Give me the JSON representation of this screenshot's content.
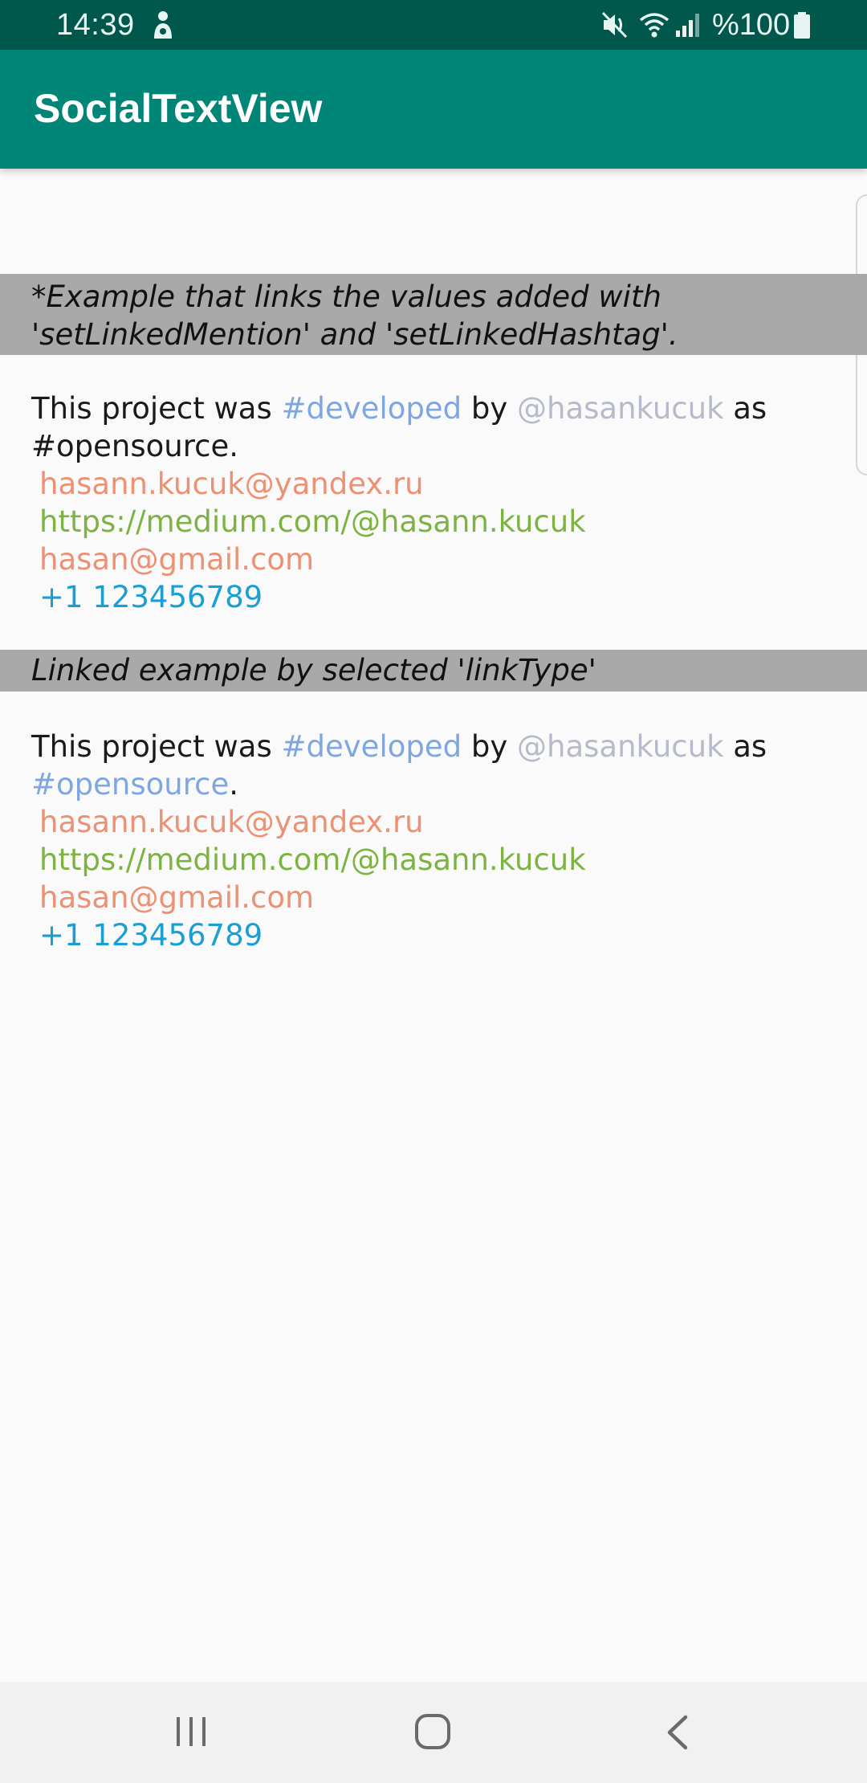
{
  "status_bar": {
    "time": "14:39",
    "battery_text": "%100",
    "icons": [
      "person-icon",
      "mute-icon",
      "wifi-icon",
      "signal-icon",
      "battery-icon"
    ]
  },
  "app_bar": {
    "title": "SocialTextView",
    "color": "#008577"
  },
  "section1": {
    "header_line1": "*Example that links the values added with",
    "header_line2": "'setLinkedMention' and 'setLinkedHashtag'.",
    "text": {
      "prefix": "This project was ",
      "hashtag1": "#developed",
      "by": " by ",
      "mention": "@hasankucuk",
      "as": " as",
      "hashtag2": "#opensource",
      "period": ".",
      "email1": "hasann.kucuk@yandex.ru",
      "url": "https://medium.com/@hasann.kucuk",
      "email2": "hasan@gmail.com",
      "phone": "+1 123456789"
    }
  },
  "section2": {
    "header": "Linked example by selected 'linkType'",
    "text": {
      "prefix": "This project was ",
      "hashtag1": "#developed",
      "by": " by ",
      "mention": "@hasankucuk",
      "as": " as",
      "hashtag2": "#opensource",
      "period": ".",
      "email1": "hasann.kucuk@yandex.ru",
      "url": "https://medium.com/@hasann.kucuk",
      "email2": "hasan@gmail.com",
      "phone": "+1 123456789"
    }
  },
  "colors": {
    "hashtag": "#7ea6e0",
    "mention": "#b7bac8",
    "email": "#ec9173",
    "url": "#7cb342",
    "phone": "#1a9ed4",
    "section_header_bg": "#a9a9a9"
  },
  "nav_bar": {
    "icons": [
      "recents-icon",
      "home-icon",
      "back-icon"
    ]
  }
}
